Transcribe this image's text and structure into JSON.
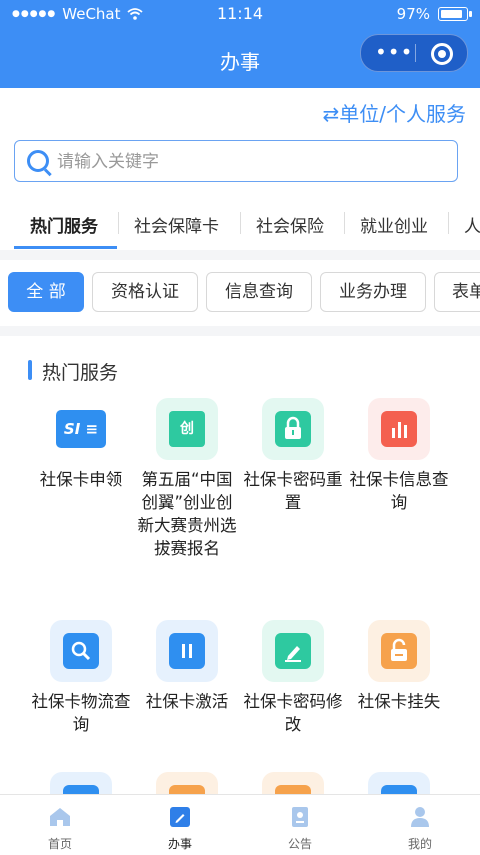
{
  "status_bar": {
    "carrier": "WeChat",
    "time": "11:14",
    "battery": "97%"
  },
  "nav": {
    "title": "办事"
  },
  "switch_link": "⇄单位/个人服务",
  "search": {
    "placeholder": "请输入关键字",
    "value": ""
  },
  "tabs": [
    "热门服务",
    "社会保障卡",
    "社会保险",
    "就业创业",
    "人"
  ],
  "chips": [
    "全 部",
    "资格认证",
    "信息查询",
    "业务办理",
    "表单"
  ],
  "section_title": "热门服务",
  "services": [
    {
      "label": "社保卡申领",
      "icon": "social-card-icon"
    },
    {
      "label": "第五届“中国创翼”创业创新大赛贵州选拔赛报名",
      "icon": "chuang-icon"
    },
    {
      "label": "社保卡密码重置",
      "icon": "lock-icon"
    },
    {
      "label": "社保卡信息查询",
      "icon": "bar-chart-icon"
    },
    {
      "label": "社保卡物流查询",
      "icon": "search-icon"
    },
    {
      "label": "社保卡激活",
      "icon": "pause-icon"
    },
    {
      "label": "社保卡密码修改",
      "icon": "edit-icon"
    },
    {
      "label": "社保卡挂失",
      "icon": "unlock-icon"
    }
  ],
  "colors": {
    "primary": "#3d8ef5",
    "green": "#2ec9a0",
    "red": "#f4604f",
    "orange": "#f6a24c"
  },
  "bottom_nav": [
    "首页",
    "办事",
    "公告",
    "我的"
  ]
}
